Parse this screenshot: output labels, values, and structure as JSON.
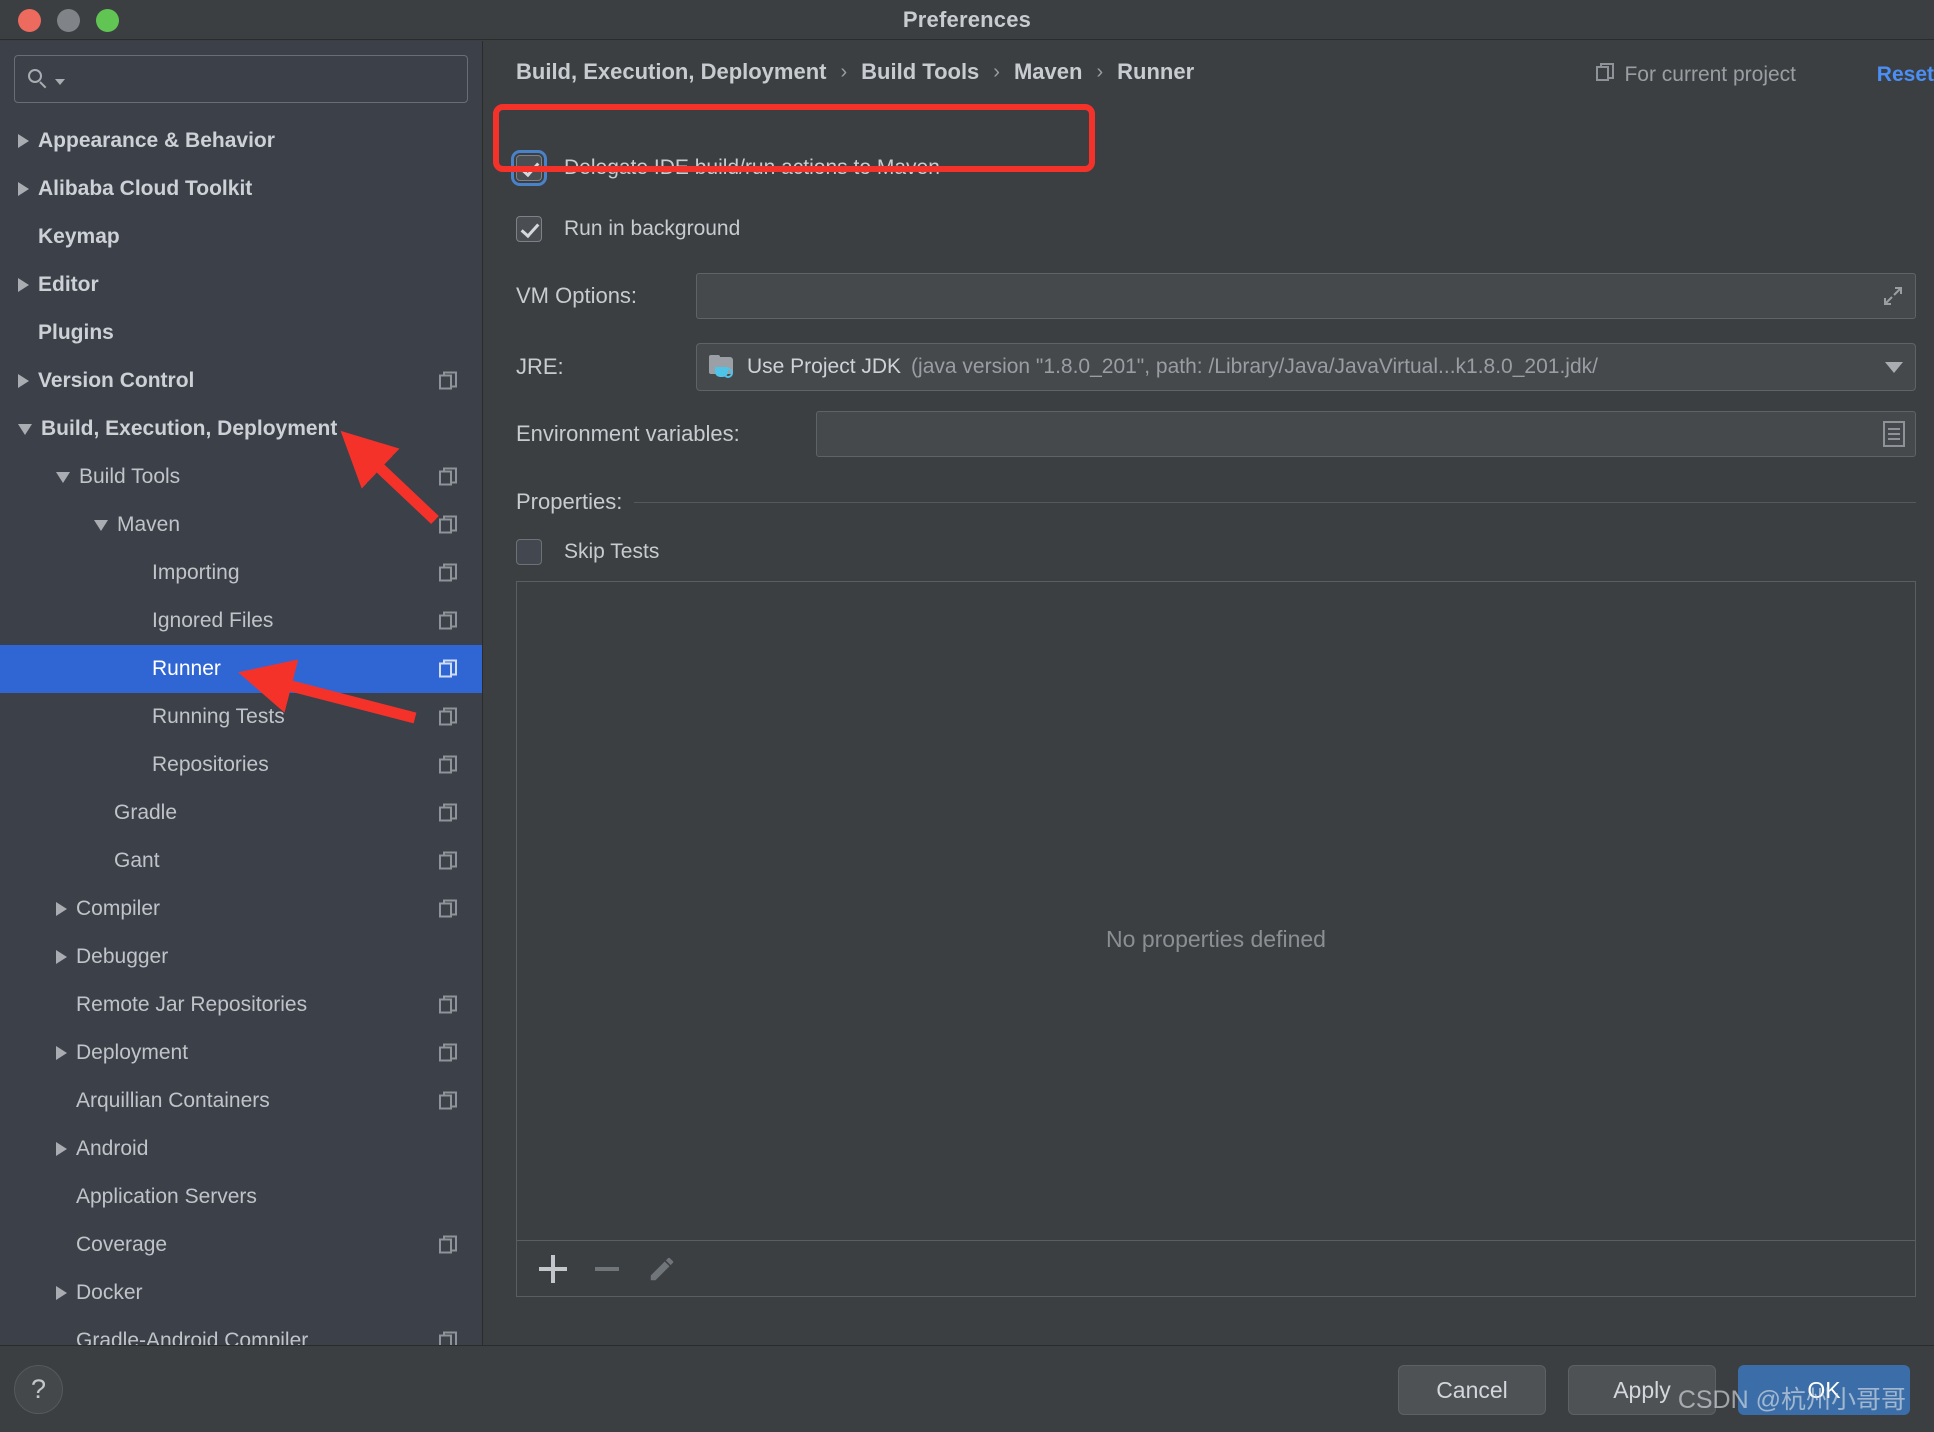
{
  "window": {
    "title": "Preferences",
    "traffic_lights": [
      "close",
      "minimize",
      "zoom"
    ]
  },
  "sidebar": {
    "search": {
      "value": "",
      "placeholder": ""
    },
    "items": [
      {
        "label": "Appearance & Behavior",
        "indent": 0,
        "arrow": "right",
        "bold": true,
        "copy": false,
        "selected": false
      },
      {
        "label": "Alibaba Cloud Toolkit",
        "indent": 0,
        "arrow": "right",
        "bold": true,
        "copy": false,
        "selected": false
      },
      {
        "label": "Keymap",
        "indent": 0,
        "arrow": "none",
        "bold": true,
        "copy": false,
        "selected": false
      },
      {
        "label": "Editor",
        "indent": 0,
        "arrow": "right",
        "bold": true,
        "copy": false,
        "selected": false
      },
      {
        "label": "Plugins",
        "indent": 0,
        "arrow": "none",
        "bold": true,
        "copy": false,
        "selected": false
      },
      {
        "label": "Version Control",
        "indent": 0,
        "arrow": "right",
        "bold": true,
        "copy": true,
        "selected": false
      },
      {
        "label": "Build, Execution, Deployment",
        "indent": 0,
        "arrow": "down",
        "bold": true,
        "copy": false,
        "selected": false
      },
      {
        "label": "Build Tools",
        "indent": 1,
        "arrow": "down",
        "bold": false,
        "copy": true,
        "selected": false
      },
      {
        "label": "Maven",
        "indent": 2,
        "arrow": "down",
        "bold": false,
        "copy": true,
        "selected": false
      },
      {
        "label": "Importing",
        "indent": 3,
        "arrow": "none",
        "bold": false,
        "copy": true,
        "selected": false
      },
      {
        "label": "Ignored Files",
        "indent": 3,
        "arrow": "none",
        "bold": false,
        "copy": true,
        "selected": false
      },
      {
        "label": "Runner",
        "indent": 3,
        "arrow": "none",
        "bold": false,
        "copy": true,
        "selected": true
      },
      {
        "label": "Running Tests",
        "indent": 3,
        "arrow": "none",
        "bold": false,
        "copy": true,
        "selected": false
      },
      {
        "label": "Repositories",
        "indent": 3,
        "arrow": "none",
        "bold": false,
        "copy": true,
        "selected": false
      },
      {
        "label": "Gradle",
        "indent": 2,
        "arrow": "none",
        "bold": false,
        "copy": true,
        "selected": false
      },
      {
        "label": "Gant",
        "indent": 2,
        "arrow": "none",
        "bold": false,
        "copy": true,
        "selected": false
      },
      {
        "label": "Compiler",
        "indent": 1,
        "arrow": "right",
        "bold": false,
        "copy": true,
        "selected": false
      },
      {
        "label": "Debugger",
        "indent": 1,
        "arrow": "right",
        "bold": false,
        "copy": false,
        "selected": false
      },
      {
        "label": "Remote Jar Repositories",
        "indent": 1,
        "arrow": "none",
        "bold": false,
        "copy": true,
        "selected": false
      },
      {
        "label": "Deployment",
        "indent": 1,
        "arrow": "right",
        "bold": false,
        "copy": true,
        "selected": false
      },
      {
        "label": "Arquillian Containers",
        "indent": 1,
        "arrow": "none",
        "bold": false,
        "copy": true,
        "selected": false
      },
      {
        "label": "Android",
        "indent": 1,
        "arrow": "right",
        "bold": false,
        "copy": false,
        "selected": false
      },
      {
        "label": "Application Servers",
        "indent": 1,
        "arrow": "none",
        "bold": false,
        "copy": false,
        "selected": false
      },
      {
        "label": "Coverage",
        "indent": 1,
        "arrow": "none",
        "bold": false,
        "copy": true,
        "selected": false
      },
      {
        "label": "Docker",
        "indent": 1,
        "arrow": "right",
        "bold": false,
        "copy": false,
        "selected": false
      },
      {
        "label": "Gradle-Android Compiler",
        "indent": 1,
        "arrow": "none",
        "bold": false,
        "copy": true,
        "selected": false
      }
    ]
  },
  "header": {
    "breadcrumb": [
      "Build, Execution, Deployment",
      "Build Tools",
      "Maven",
      "Runner"
    ],
    "separator": "›",
    "for_current_project": "For current project",
    "reset": "Reset",
    "reset_color": "#4b8ef5"
  },
  "main": {
    "delegate_checkbox": {
      "label": "Delegate IDE build/run actions to Maven",
      "checked": true,
      "focused": true
    },
    "run_background_checkbox": {
      "label": "Run in background",
      "checked": true,
      "focused": false
    },
    "vm_options": {
      "label": "VM Options:",
      "value": "",
      "expand_icon": "expand-icon"
    },
    "jre": {
      "label": "JRE:",
      "value_main": "Use Project JDK",
      "value_detail": "(java version \"1.8.0_201\", path: /Library/Java/JavaVirtual...k1.8.0_201.jdk/"
    },
    "env_vars": {
      "label": "Environment variables:",
      "value": ""
    },
    "properties": {
      "label": "Properties:",
      "skip_tests": {
        "label": "Skip Tests",
        "checked": false
      },
      "empty_text": "No properties defined",
      "toolbar": {
        "add": "+",
        "remove": "−",
        "edit": "pencil"
      }
    }
  },
  "footer": {
    "help": "?",
    "cancel": "Cancel",
    "apply": "Apply",
    "ok": "OK",
    "ok_color": "#3b6ea8"
  },
  "watermark": "CSDN @杭州小哥哥",
  "annotations": {
    "highlight_color": "#f5322a",
    "box_target": "delegate-ide-build-run-actions-checkbox-row",
    "arrow_targets": [
      "build-execution-deployment-tree-item",
      "runner-tree-item"
    ]
  }
}
